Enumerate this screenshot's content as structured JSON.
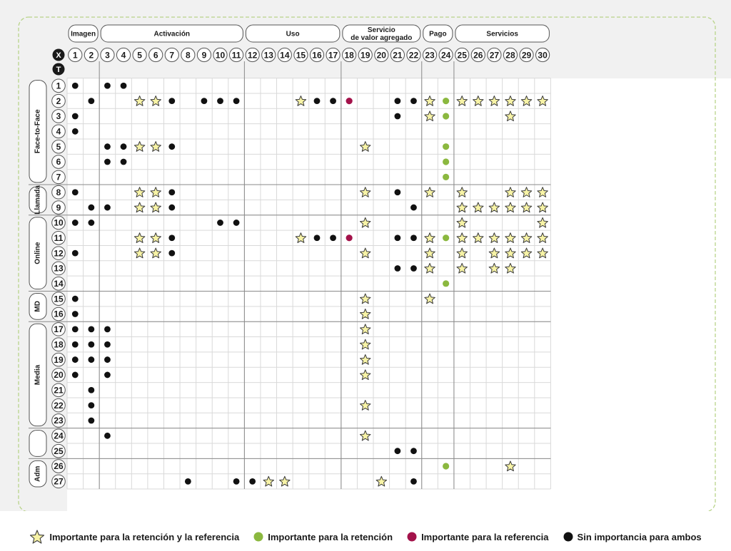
{
  "axis_letters": {
    "x": "X",
    "t": "T"
  },
  "categories": [
    {
      "label": "Imagen",
      "from": 1,
      "to": 2
    },
    {
      "label": "Activación",
      "from": 3,
      "to": 11
    },
    {
      "label": "Uso",
      "from": 12,
      "to": 17
    },
    {
      "label": "Servicio\nde valor agregado",
      "from": 18,
      "to": 22
    },
    {
      "label": "Pago",
      "from": 23,
      "to": 24
    },
    {
      "label": "Servicios",
      "from": 25,
      "to": 30
    }
  ],
  "columns": [
    "1",
    "2",
    "3",
    "4",
    "5",
    "6",
    "7",
    "8",
    "9",
    "10",
    "11",
    "12",
    "13",
    "14",
    "15",
    "16",
    "17",
    "18",
    "19",
    "20",
    "21",
    "22",
    "23",
    "24",
    "25",
    "26",
    "27",
    "28",
    "29",
    "30"
  ],
  "rows": [
    "1",
    "2",
    "3",
    "4",
    "5",
    "6",
    "7",
    "8",
    "9",
    "10",
    "11",
    "12",
    "13",
    "14",
    "15",
    "16",
    "17",
    "18",
    "19",
    "20",
    "21",
    "22",
    "23",
    "24",
    "25",
    "26",
    "27"
  ],
  "groups": [
    {
      "label": "Face-to-Face",
      "from": 1,
      "to": 7
    },
    {
      "label": "Llamada",
      "from": 8,
      "to": 9
    },
    {
      "label": "Online",
      "from": 10,
      "to": 14
    },
    {
      "label": "MD",
      "from": 15,
      "to": 16
    },
    {
      "label": "Media",
      "from": 17,
      "to": 23
    },
    {
      "label": "",
      "from": 24,
      "to": 25
    },
    {
      "label": "Adm",
      "from": 26,
      "to": 27
    }
  ],
  "cells": {
    "1": {
      "dot": [
        1,
        3,
        4
      ]
    },
    "2": {
      "dot": [
        2,
        7,
        9,
        10,
        11,
        16,
        17,
        21,
        22
      ],
      "star": [
        5,
        6,
        15,
        23,
        25,
        26,
        27,
        28,
        29,
        30
      ],
      "green": [
        24
      ],
      "red": [
        18
      ]
    },
    "3": {
      "dot": [
        1,
        21
      ],
      "star": [
        23,
        28
      ],
      "green": [
        24
      ]
    },
    "4": {
      "dot": [
        1
      ]
    },
    "5": {
      "dot": [
        3,
        4,
        7
      ],
      "star": [
        5,
        6,
        19
      ],
      "green": [
        24
      ]
    },
    "6": {
      "dot": [
        3,
        4
      ],
      "green": [
        24
      ]
    },
    "7": {
      "green": [
        24
      ]
    },
    "8": {
      "dot": [
        1,
        7,
        21
      ],
      "star": [
        5,
        6,
        19,
        23,
        25,
        28,
        29,
        30
      ]
    },
    "9": {
      "dot": [
        2,
        3,
        7,
        22
      ],
      "star": [
        5,
        6,
        25,
        26,
        27,
        28,
        29,
        30
      ]
    },
    "10": {
      "dot": [
        1,
        2,
        10,
        11
      ],
      "star": [
        19,
        25,
        30
      ]
    },
    "11": {
      "dot": [
        7,
        16,
        17,
        21,
        22
      ],
      "star": [
        5,
        6,
        15,
        23,
        25,
        26,
        27,
        28,
        29,
        30
      ],
      "green": [
        24
      ],
      "red": [
        18
      ]
    },
    "12": {
      "dot": [
        1,
        7
      ],
      "star": [
        5,
        6,
        19,
        23,
        25,
        27,
        28,
        29,
        30
      ]
    },
    "13": {
      "dot": [
        21,
        22
      ],
      "star": [
        23,
        25,
        27,
        28
      ]
    },
    "14": {
      "green": [
        24
      ]
    },
    "15": {
      "dot": [
        1
      ],
      "star": [
        19,
        23
      ]
    },
    "16": {
      "dot": [
        1
      ],
      "star": [
        19
      ]
    },
    "17": {
      "dot": [
        1,
        2,
        3
      ],
      "star": [
        19
      ]
    },
    "18": {
      "dot": [
        1,
        2,
        3
      ],
      "star": [
        19
      ]
    },
    "19": {
      "dot": [
        1,
        2,
        3
      ],
      "star": [
        19
      ]
    },
    "20": {
      "dot": [
        1,
        3
      ],
      "star": [
        19
      ]
    },
    "21": {
      "dot": [
        2
      ]
    },
    "22": {
      "dot": [
        2
      ],
      "star": [
        19
      ]
    },
    "23": {
      "dot": [
        2
      ]
    },
    "24": {
      "dot": [
        3
      ],
      "star": [
        19
      ]
    },
    "25": {
      "dot": [
        21,
        22
      ]
    },
    "26": {
      "green": [
        24
      ],
      "star": [
        28
      ]
    },
    "27": {
      "dot": [
        8,
        11,
        12,
        22
      ],
      "star": [
        13,
        14,
        20
      ]
    }
  },
  "colors": {
    "star_fill": "#f7f3a6",
    "green": "#8bb83f",
    "red": "#a3124a",
    "dot": "#111111",
    "dashed_border": "#b9d48a",
    "panel": "#f1f1f1",
    "grid": "#d9d9d9"
  },
  "legend": [
    {
      "icon": "star",
      "label": "Importante para la retención y la referencia"
    },
    {
      "icon": "green",
      "label": "Importante para la retención"
    },
    {
      "icon": "red",
      "label": "Importante para la referencia"
    },
    {
      "icon": "dot",
      "label": "Sin importancia para ambos"
    }
  ]
}
